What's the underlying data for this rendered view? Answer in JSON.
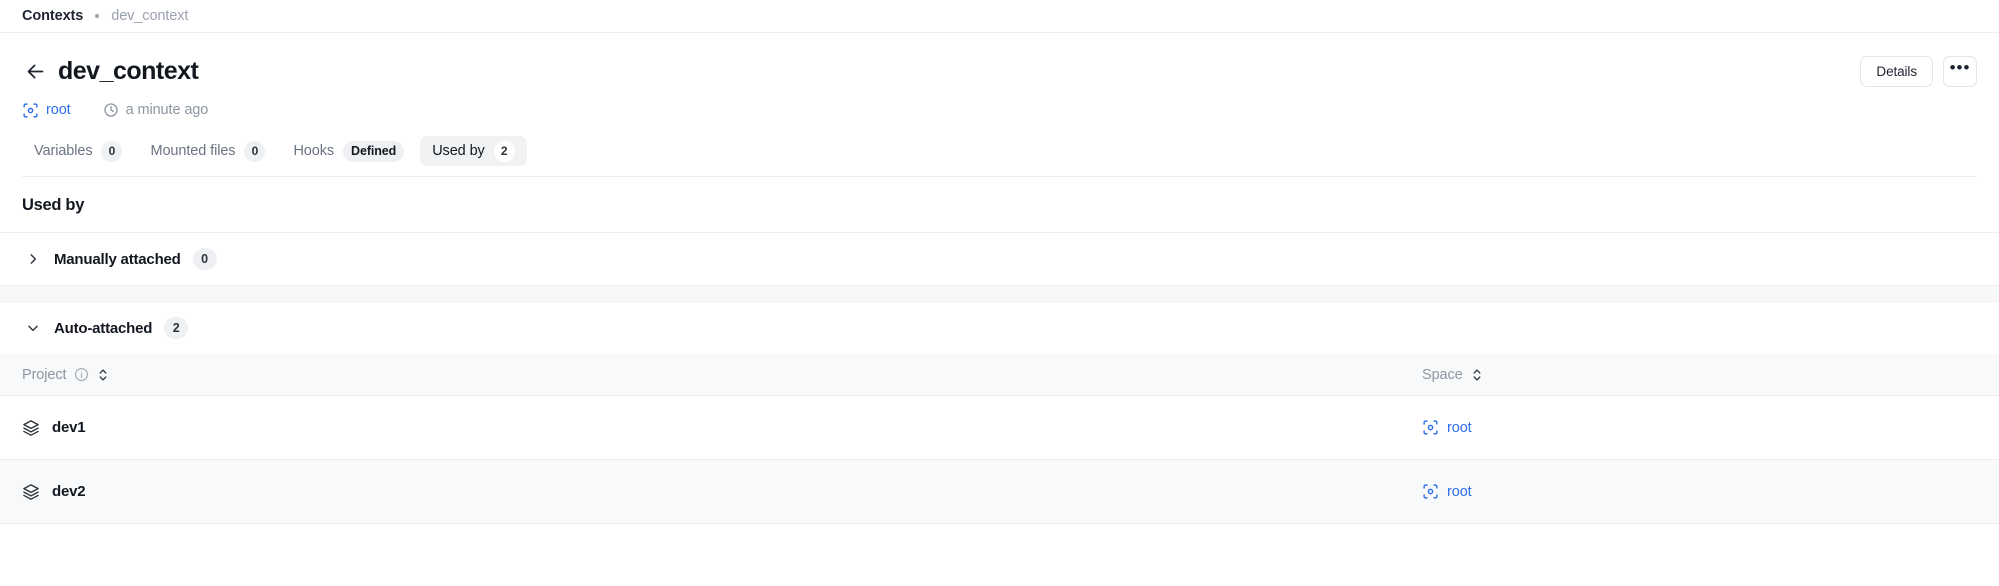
{
  "breadcrumb": {
    "root": "Contexts",
    "current": "dev_context",
    "separator_icon": "dot-separator"
  },
  "header": {
    "back_icon": "arrow-left-icon",
    "title": "dev_context",
    "details_label": "Details",
    "more_label": "•••",
    "space_icon": "space-target-icon",
    "space_name": "root",
    "clock_icon": "clock-icon",
    "updated": "a minute ago"
  },
  "tabs": [
    {
      "label": "Variables",
      "badge": "0",
      "badge_type": "count",
      "active": false,
      "name": "tab-variables"
    },
    {
      "label": "Mounted files",
      "badge": "0",
      "badge_type": "count",
      "active": false,
      "name": "tab-mounted-files"
    },
    {
      "label": "Hooks",
      "badge": "Defined",
      "badge_type": "text",
      "active": false,
      "name": "tab-hooks"
    },
    {
      "label": "Used by",
      "badge": "2",
      "badge_type": "count",
      "active": true,
      "name": "tab-used-by"
    }
  ],
  "section": {
    "title": "Used by"
  },
  "accordions": [
    {
      "label": "Manually attached",
      "count": "0",
      "expanded": false,
      "chevron_icon": "chevron-right-icon",
      "name": "accordion-manually-attached"
    },
    {
      "label": "Auto-attached",
      "count": "2",
      "expanded": true,
      "chevron_icon": "chevron-down-icon",
      "name": "accordion-auto-attached"
    }
  ],
  "table": {
    "columns": [
      {
        "label": "Project",
        "has_info": true,
        "sort_icon": "sort-chevrons-icon",
        "info_icon": "info-icon"
      },
      {
        "label": "Space",
        "has_info": false,
        "sort_icon": "sort-chevrons-icon"
      }
    ],
    "rows": [
      {
        "project": "dev1",
        "project_icon": "layers-icon",
        "space": "root",
        "space_icon": "space-target-icon",
        "hovered": false
      },
      {
        "project": "dev2",
        "project_icon": "layers-icon",
        "space": "root",
        "space_icon": "space-target-icon",
        "hovered": true
      }
    ]
  },
  "colors": {
    "accent": "#2f6feb",
    "text": "#131820",
    "muted": "#8d96a3",
    "border": "#eceef1",
    "row_hover": "#f8f9fb",
    "pill_bg": "#eef0f3"
  }
}
